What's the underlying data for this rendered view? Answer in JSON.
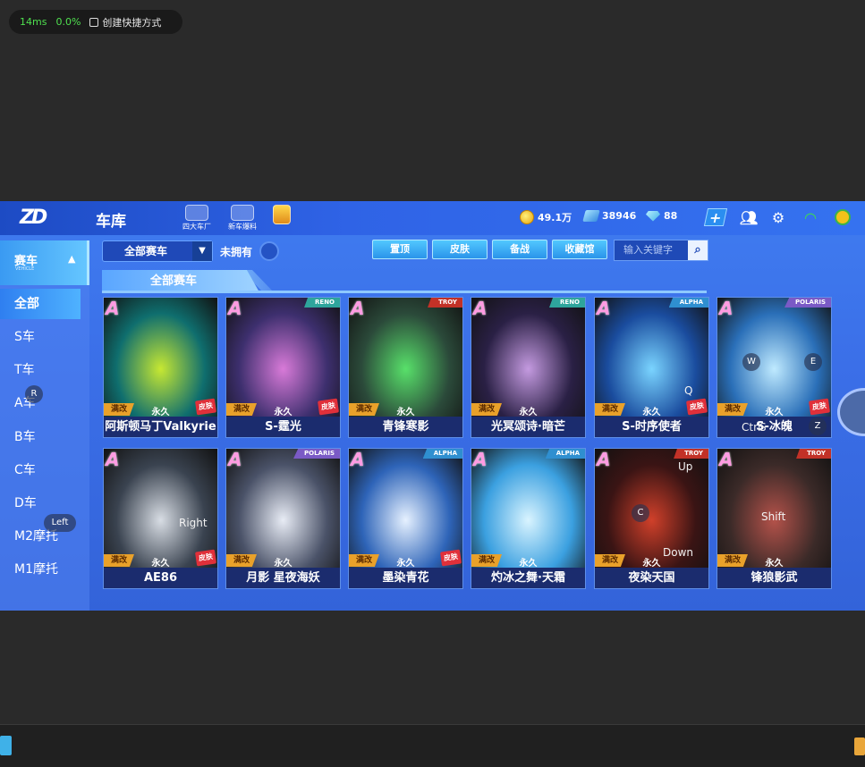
{
  "overlay": {
    "latency": "14ms",
    "percent": "0.0%",
    "shortcut": "创建快捷方式"
  },
  "topbar": {
    "title": "车库",
    "icons": [
      {
        "label": "四大车厂"
      },
      {
        "label": "新车爆料"
      }
    ],
    "coins": "49.1万",
    "tickets": "38946",
    "diamonds": "88"
  },
  "sidebar": {
    "header": "赛车",
    "header_sub": "VEHICLE",
    "items": [
      "全部",
      "S车",
      "T车",
      "A车",
      "B车",
      "C车",
      "D车",
      "M2摩托",
      "M1摩托"
    ]
  },
  "filter": {
    "selected": "全部赛车",
    "not_owned": "未拥有",
    "buttons": [
      "置顶",
      "皮肤",
      "备战",
      "收藏馆"
    ],
    "search_placeholder": "输入关键字"
  },
  "section": {
    "title": "全部赛车"
  },
  "cards": [
    {
      "name": "阿斯顿马丁Valkyrie",
      "rank": "A",
      "brand": "",
      "brand_type": "none",
      "mod": "满改",
      "perm": "永久",
      "skin": "皮肤",
      "c1": "#0f6e6e",
      "c2": "#c7e832"
    },
    {
      "name": "S-霆光",
      "rank": "A",
      "brand": "RENO",
      "brand_type": "reno",
      "mod": "满改",
      "perm": "永久",
      "skin": "皮肤",
      "c1": "#3d2f6e",
      "c2": "#d87ad8"
    },
    {
      "name": "青锋寒影",
      "rank": "A",
      "brand": "TROY",
      "brand_type": "troy",
      "mod": "满改",
      "perm": "永久",
      "skin": "",
      "c1": "#2b4a3a",
      "c2": "#58e06a"
    },
    {
      "name": "光冥颂诗·暗芒",
      "rank": "A",
      "brand": "RENO",
      "brand_type": "reno",
      "mod": "满改",
      "perm": "永久",
      "skin": "",
      "c1": "#2a2045",
      "c2": "#c49ae0"
    },
    {
      "name": "S-时序使者",
      "rank": "A",
      "brand": "ALPHA",
      "brand_type": "alpha",
      "mod": "满改",
      "perm": "永久",
      "skin": "皮肤",
      "c1": "#1a4c9e",
      "c2": "#7ad4ff"
    },
    {
      "name": "S-冰魄",
      "rank": "A",
      "brand": "POLARIS",
      "brand_type": "polaris",
      "mod": "满改",
      "perm": "永久",
      "skin": "皮肤",
      "c1": "#2a6fb8",
      "c2": "#bfeaff"
    },
    {
      "name": "AE86",
      "rank": "A",
      "brand": "",
      "brand_type": "none",
      "mod": "满改",
      "perm": "永久",
      "skin": "皮肤",
      "c1": "#3a4350",
      "c2": "#d8dde4"
    },
    {
      "name": "月影 星夜海妖",
      "rank": "A",
      "brand": "POLARIS",
      "brand_type": "polaris",
      "mod": "满改",
      "perm": "永久",
      "skin": "",
      "c1": "#4a5268",
      "c2": "#e8ecf5"
    },
    {
      "name": "墨染青花",
      "rank": "A",
      "brand": "ALPHA",
      "brand_type": "alpha",
      "mod": "满改",
      "perm": "永久",
      "skin": "皮肤",
      "c1": "#2e64b8",
      "c2": "#e6f1ff"
    },
    {
      "name": "灼冰之舞·天霜",
      "rank": "A",
      "brand": "ALPHA",
      "brand_type": "alpha",
      "mod": "满改",
      "perm": "永久",
      "skin": "",
      "c1": "#3ba0e0",
      "c2": "#d9f4ff"
    },
    {
      "name": "夜染天国",
      "rank": "A",
      "brand": "TROY",
      "brand_type": "troy",
      "mod": "满改",
      "perm": "永久",
      "skin": "",
      "c1": "#3a1414",
      "c2": "#d0402a"
    },
    {
      "name": "锋狼影武",
      "rank": "A",
      "brand": "TROY",
      "brand_type": "troy",
      "mod": "满改",
      "perm": "永久",
      "skin": "",
      "c1": "#3b2a28",
      "c2": "#b4524a"
    }
  ],
  "key_hints": {
    "R": "R",
    "Left": "Left",
    "Right": "Right",
    "W": "W",
    "E": "E",
    "Q": "Q",
    "Ctrl": "Ctrl",
    "S": "S",
    "Z": "Z",
    "Up": "Up",
    "C": "C",
    "Down": "Down",
    "Shift": "Shift"
  }
}
